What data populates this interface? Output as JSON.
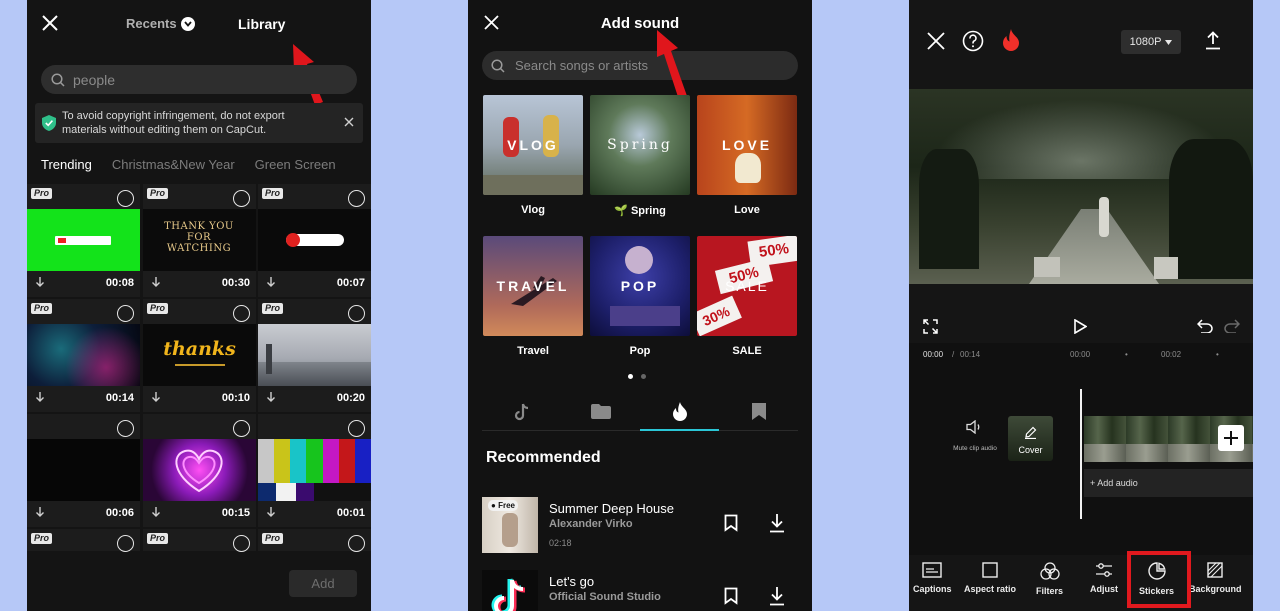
{
  "panel_library": {
    "tab_recents": "Recents",
    "tab_library": "Library",
    "search_value": "people",
    "notice_text": "To avoid copyright infringement, do not export materials without editing them on CapCut.",
    "categories": [
      "Trending",
      "Christmas&New Year",
      "Green Screen"
    ],
    "items": [
      {
        "pro": "Pro",
        "duration": "00:08",
        "thumb_text": ""
      },
      {
        "pro": "Pro",
        "duration": "00:30",
        "thumb_text": "THANK YOU FOR WATCHING"
      },
      {
        "pro": "Pro",
        "duration": "00:07",
        "thumb_text": ""
      },
      {
        "pro": "Pro",
        "duration": "00:14",
        "thumb_text": ""
      },
      {
        "pro": "Pro",
        "duration": "00:10",
        "thumb_text": "thanks"
      },
      {
        "pro": "Pro",
        "duration": "00:20",
        "thumb_text": ""
      },
      {
        "pro": "",
        "duration": "00:06",
        "thumb_text": ""
      },
      {
        "pro": "",
        "duration": "00:15",
        "thumb_text": ""
      },
      {
        "pro": "",
        "duration": "00:01",
        "thumb_text": ""
      },
      {
        "pro": "Pro",
        "duration": "",
        "thumb_text": ""
      },
      {
        "pro": "Pro",
        "duration": "",
        "thumb_text": ""
      },
      {
        "pro": "Pro",
        "duration": "",
        "thumb_text": ""
      }
    ],
    "add_button": "Add"
  },
  "panel_sound": {
    "title": "Add sound",
    "search_placeholder": "Search songs or artists",
    "tiles": [
      {
        "word": "VLOG",
        "label": "Vlog"
      },
      {
        "word": "Spring",
        "label": "Spring"
      },
      {
        "word": "LOVE",
        "label": "Love"
      },
      {
        "word": "TRAVEL",
        "label": "Travel"
      },
      {
        "word": "POP",
        "label": "Pop"
      },
      {
        "word": "SALE",
        "label": "SALE"
      }
    ],
    "section_title": "Recommended",
    "songs": [
      {
        "name": "Summer Deep House",
        "artist": "Alexander Virko",
        "duration": "02:18",
        "badge": "Free"
      },
      {
        "name": "Let's go",
        "artist": "Official Sound Studio",
        "duration": "",
        "badge": ""
      }
    ]
  },
  "panel_editor": {
    "resolution": "1080P",
    "time_current": "00:00",
    "time_total": "00:14",
    "tick_0": "00:00",
    "tick_2": "00:02",
    "mute_label": "Mute clip audio",
    "cover_label": "Cover",
    "add_audio": "+ Add audio",
    "tools": [
      "Captions",
      "Aspect ratio",
      "Filters",
      "Adjust",
      "Stickers",
      "Background"
    ],
    "highlight_color": "#e1191e"
  }
}
